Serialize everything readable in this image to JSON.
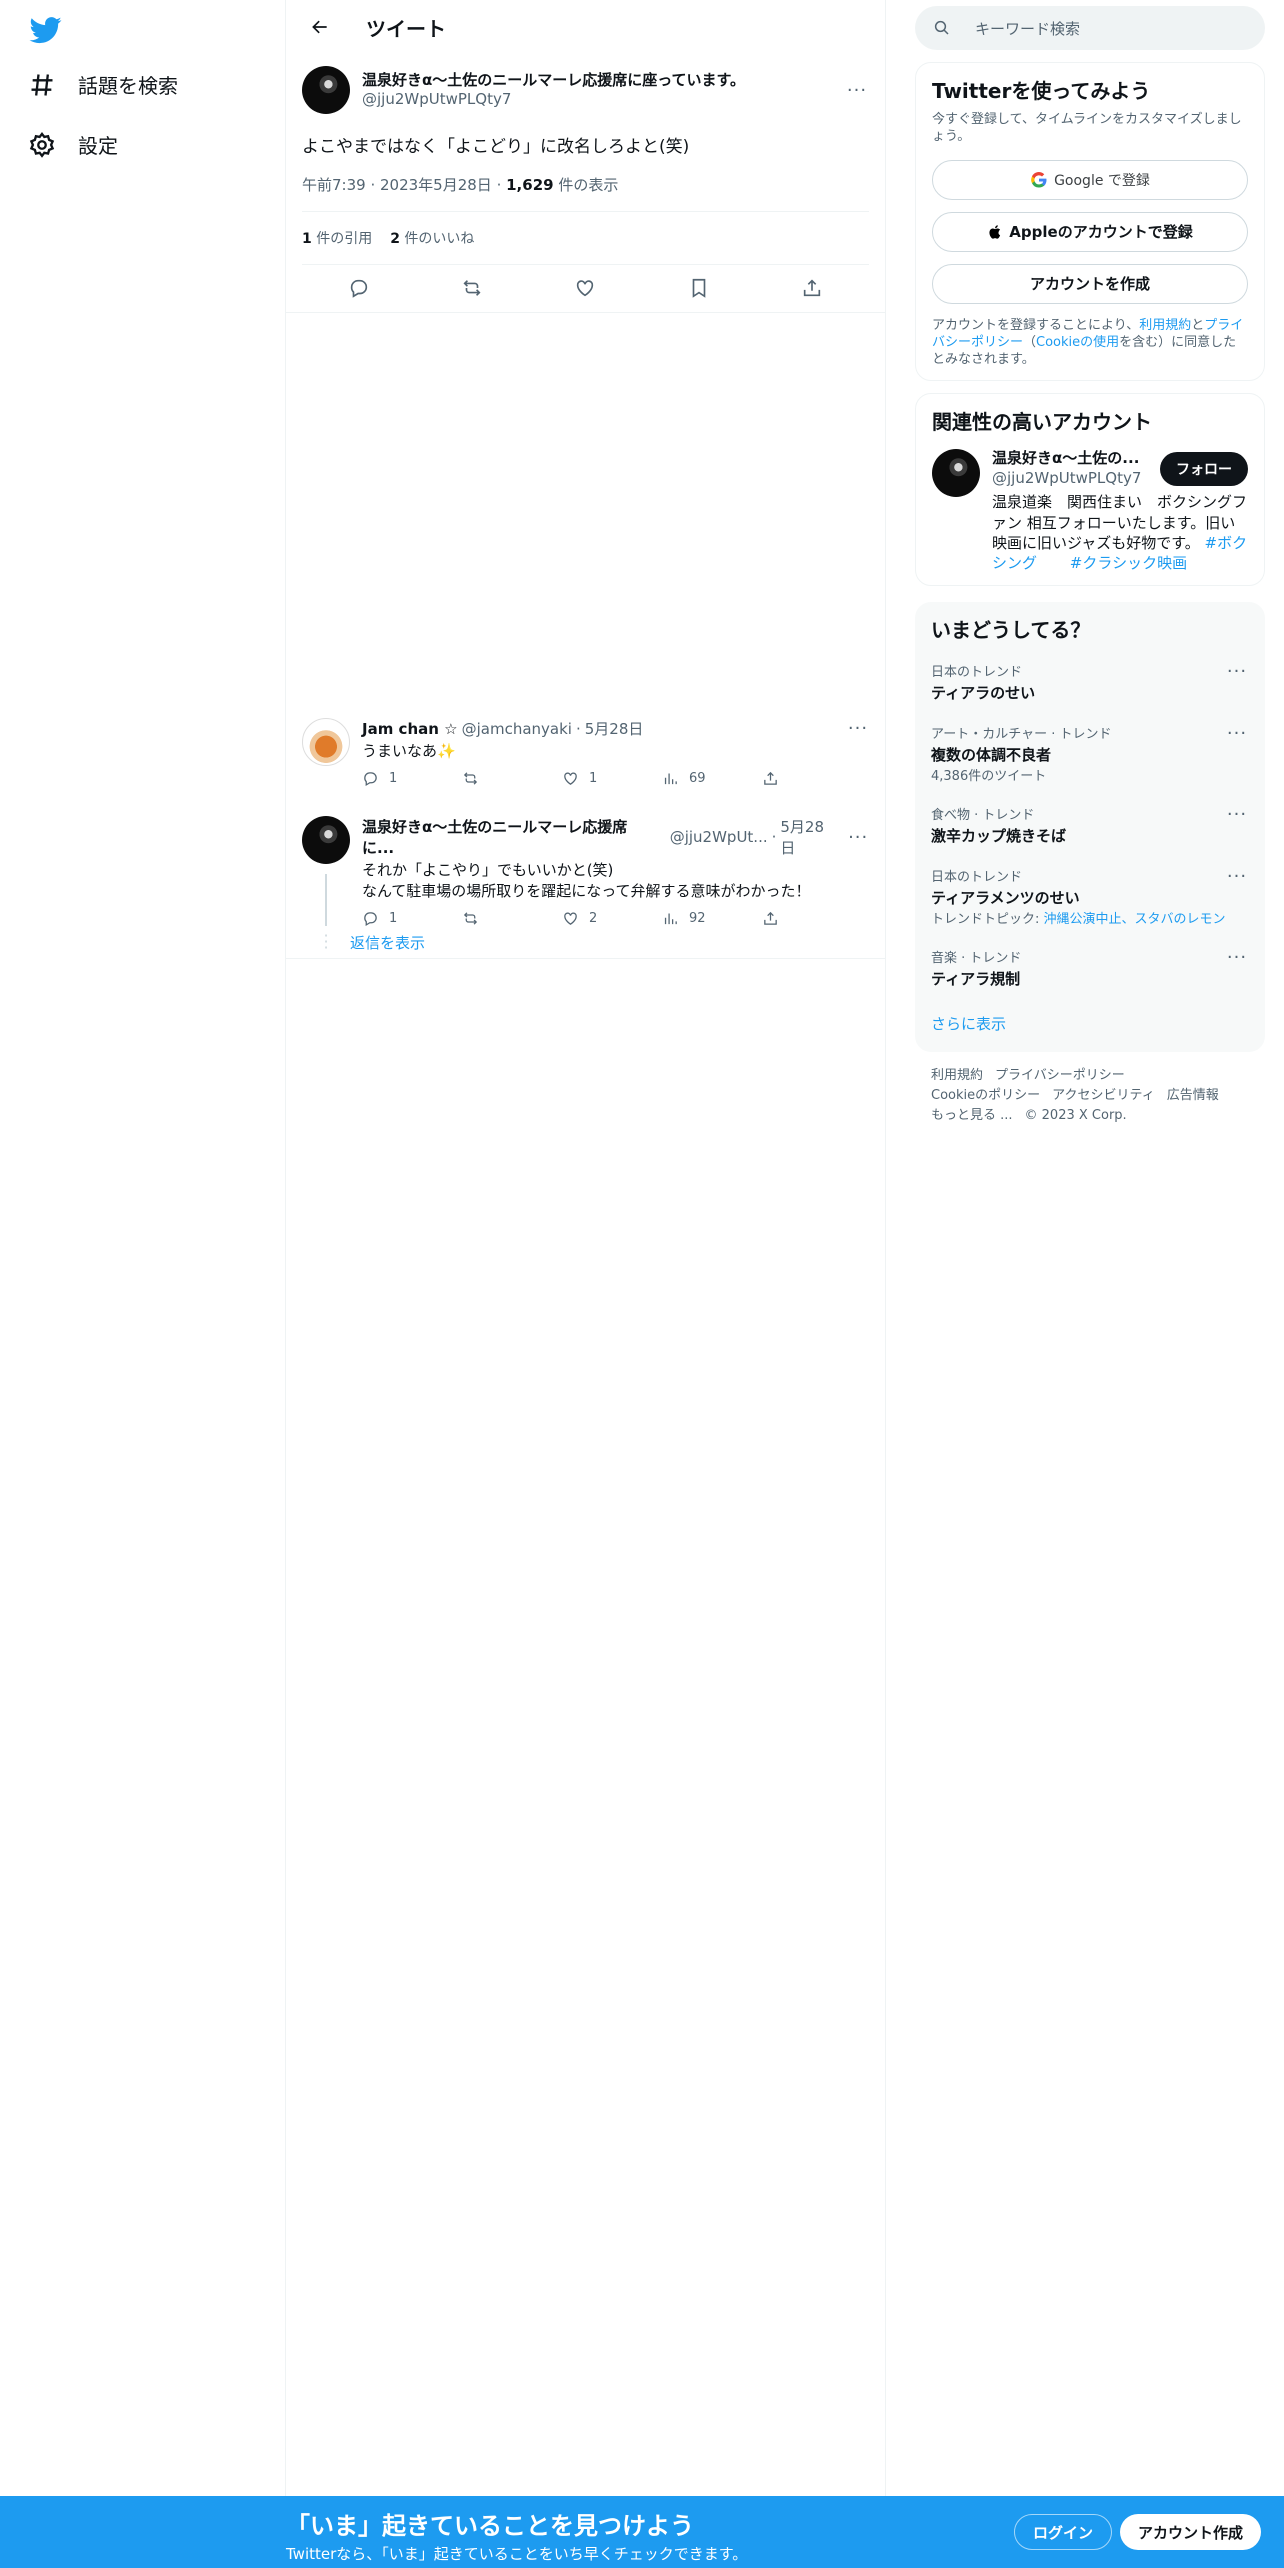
{
  "nav": {
    "explore_label": "話題を検索",
    "settings_label": "設定"
  },
  "header": {
    "title": "ツイート"
  },
  "main_tweet": {
    "name": "温泉好きα〜土佐のニールマーレ応援席に座っています。",
    "handle": "@jju2WpUtwPLQty7",
    "text": "よこやまではなく「よこどり」に改名しろよと(笑)",
    "time": "午前7:39",
    "date": "2023年5月28日",
    "views_count": "1,629",
    "views_label": " 件の表示",
    "quotes_count": "1",
    "quotes_label": " 件の引用",
    "likes_count": "2",
    "likes_label": " 件のいいね"
  },
  "replies": [
    {
      "name": "Jam chan ☆",
      "handle": "@jamchanyaki",
      "date": "5月28日",
      "text": "うまいなあ✨",
      "replies": "1",
      "retweets": "",
      "likes": "1",
      "views": "69"
    },
    {
      "name": "温泉好きα〜土佐のニールマーレ応援席に...",
      "handle": "@jju2WpUt...",
      "date": "5月28日",
      "text_line1": "それか「よこやり」でもいいかと(笑)",
      "text_line2": "なんて駐車場の場所取りを躍起になって弁解する意味がわかった！",
      "replies": "1",
      "retweets": "",
      "likes": "2",
      "views": "92"
    }
  ],
  "show_replies_label": "返信を表示",
  "search": {
    "placeholder": "キーワード検索"
  },
  "signup_card": {
    "title": "Twitterを使ってみよう",
    "subtitle": "今すぐ登録して、タイムラインをカスタマイズしましょう。",
    "google_label": "Google で登録",
    "apple_label": "Appleのアカウントで登録",
    "create_label": "アカウントを作成",
    "legal_1": "アカウントを登録することにより、",
    "legal_terms": "利用規約",
    "legal_2": "と",
    "legal_privacy": "プライバシーポリシー",
    "legal_3": "（",
    "legal_cookie": "Cookieの使用",
    "legal_4": "を含む）に同意したとみなされます。"
  },
  "related": {
    "title": "関連性の高いアカウント",
    "name": "温泉好きα〜土佐の...",
    "handle": "@jju2WpUtwPLQty7",
    "follow_label": "フォロー",
    "bio": "温泉道楽　関西住まい　ボクシングファン 相互フォローいたします。旧い映画に旧いジャズも好物です。",
    "tag1": "#ボクシング",
    "tag2": "#クラシック映画"
  },
  "trends": {
    "title": "いまどうしてる？",
    "items": [
      {
        "meta": "日本のトレンド",
        "name": "ティアラのせい",
        "extra": ""
      },
      {
        "meta": "アート・カルチャー · トレンド",
        "name": "複数の体調不良者",
        "extra": "4,386件のツイート"
      },
      {
        "meta": "食べ物 · トレンド",
        "name": "激辛カップ焼きそば",
        "extra": ""
      },
      {
        "meta": "日本のトレンド",
        "name": "ティアラメンツのせい",
        "extra": ""
      },
      {
        "meta": "音楽 · トレンド",
        "name": "ティアラ規制",
        "extra": ""
      }
    ],
    "topic_label": "トレンドトピック: ",
    "topic_links": "沖縄公演中止、スタバのレモン",
    "show_more": "さらに表示"
  },
  "footer": {
    "terms": "利用規約",
    "privacy": "プライバシーポリシー",
    "cookie": "Cookieのポリシー",
    "accessibility": "アクセシビリティ",
    "ads": "広告情報",
    "more": "もっと見る ...",
    "copyright": "© 2023 X Corp."
  },
  "bottom_bar": {
    "title": "「いま」起きていることを見つけよう",
    "subtitle": "Twitterなら、「いま」起きていることをいち早くチェックできます。",
    "login_label": "ログイン",
    "signup_label": "アカウント作成"
  },
  "colors": {
    "brand": "#1d9bf0",
    "text": "#0f1419",
    "secondary": "#536471"
  }
}
